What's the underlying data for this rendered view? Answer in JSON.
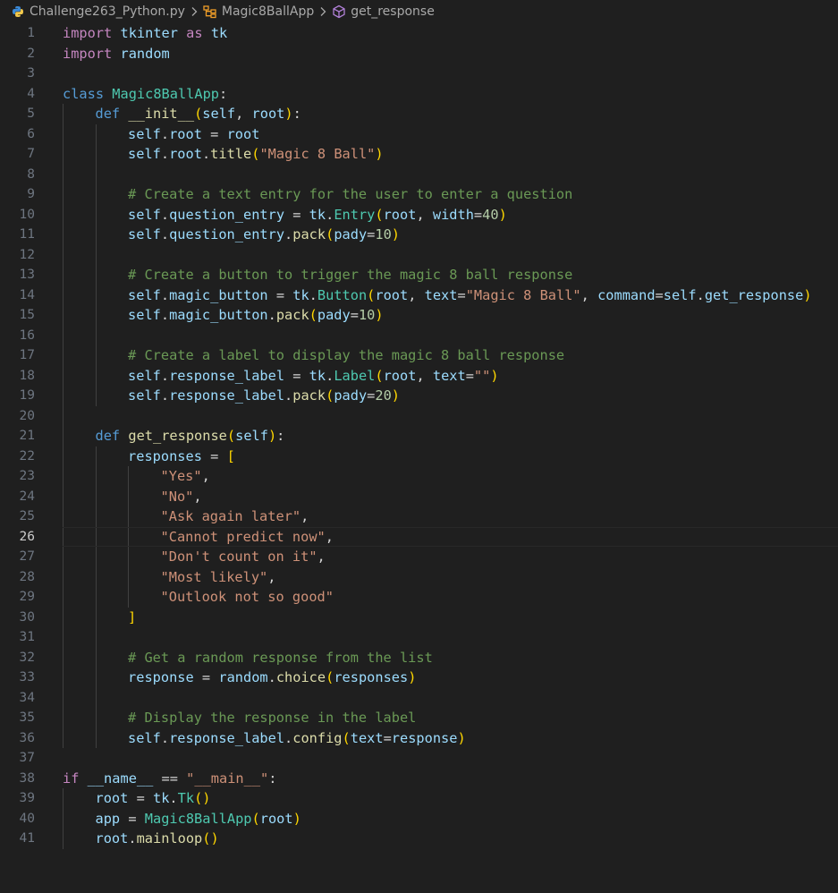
{
  "breadcrumb": {
    "file": "Challenge263_Python.py",
    "class_name": "Magic8BallApp",
    "method_name": "get_response"
  },
  "current_line": 26,
  "colors": {
    "background": "#1f1f1f",
    "line_number": "#6e7681",
    "keyword": "#569cd6",
    "control_keyword": "#c586c0",
    "variable": "#9cdcfe",
    "class": "#4ec9b0",
    "function": "#dcdcaa",
    "string": "#ce9178",
    "number": "#b5cea8",
    "comment": "#6a9955",
    "bracket_level1": "#ffd700",
    "bracket_level2": "#da70d6"
  },
  "lines": [
    {
      "n": "1",
      "indent": 0,
      "tokens": [
        [
          "kc",
          "import"
        ],
        [
          "p",
          " "
        ],
        [
          "n",
          "tkinter"
        ],
        [
          "p",
          " "
        ],
        [
          "kc",
          "as"
        ],
        [
          "p",
          " "
        ],
        [
          "n",
          "tk"
        ]
      ]
    },
    {
      "n": "2",
      "indent": 0,
      "tokens": [
        [
          "kc",
          "import"
        ],
        [
          "p",
          " "
        ],
        [
          "n",
          "random"
        ]
      ]
    },
    {
      "n": "3",
      "indent": 0,
      "tokens": []
    },
    {
      "n": "4",
      "indent": 0,
      "tokens": [
        [
          "k",
          "class"
        ],
        [
          "p",
          " "
        ],
        [
          "c",
          "Magic8BallApp"
        ],
        [
          "p",
          ":"
        ]
      ]
    },
    {
      "n": "5",
      "indent": 1,
      "tokens": [
        [
          "k",
          "def"
        ],
        [
          "p",
          " "
        ],
        [
          "f",
          "__init__"
        ],
        [
          "b1",
          "("
        ],
        [
          "n",
          "self"
        ],
        [
          "p",
          ", "
        ],
        [
          "n",
          "root"
        ],
        [
          "b1",
          ")"
        ],
        [
          "p",
          ":"
        ]
      ]
    },
    {
      "n": "6",
      "indent": 2,
      "tokens": [
        [
          "n",
          "self"
        ],
        [
          "p",
          "."
        ],
        [
          "n",
          "root"
        ],
        [
          "p",
          " = "
        ],
        [
          "n",
          "root"
        ]
      ]
    },
    {
      "n": "7",
      "indent": 2,
      "tokens": [
        [
          "n",
          "self"
        ],
        [
          "p",
          "."
        ],
        [
          "n",
          "root"
        ],
        [
          "p",
          "."
        ],
        [
          "f",
          "title"
        ],
        [
          "b1",
          "("
        ],
        [
          "s",
          "\"Magic 8 Ball\""
        ],
        [
          "b1",
          ")"
        ]
      ]
    },
    {
      "n": "8",
      "indent": 2,
      "tokens": []
    },
    {
      "n": "9",
      "indent": 2,
      "tokens": [
        [
          "cm",
          "# Create a text entry for the user to enter a question"
        ]
      ]
    },
    {
      "n": "10",
      "indent": 2,
      "tokens": [
        [
          "n",
          "self"
        ],
        [
          "p",
          "."
        ],
        [
          "n",
          "question_entry"
        ],
        [
          "p",
          " = "
        ],
        [
          "n",
          "tk"
        ],
        [
          "p",
          "."
        ],
        [
          "c",
          "Entry"
        ],
        [
          "b1",
          "("
        ],
        [
          "n",
          "root"
        ],
        [
          "p",
          ", "
        ],
        [
          "n",
          "width"
        ],
        [
          "p",
          "="
        ],
        [
          "num",
          "40"
        ],
        [
          "b1",
          ")"
        ]
      ]
    },
    {
      "n": "11",
      "indent": 2,
      "tokens": [
        [
          "n",
          "self"
        ],
        [
          "p",
          "."
        ],
        [
          "n",
          "question_entry"
        ],
        [
          "p",
          "."
        ],
        [
          "f",
          "pack"
        ],
        [
          "b1",
          "("
        ],
        [
          "n",
          "pady"
        ],
        [
          "p",
          "="
        ],
        [
          "num",
          "10"
        ],
        [
          "b1",
          ")"
        ]
      ]
    },
    {
      "n": "12",
      "indent": 2,
      "tokens": []
    },
    {
      "n": "13",
      "indent": 2,
      "tokens": [
        [
          "cm",
          "# Create a button to trigger the magic 8 ball response"
        ]
      ]
    },
    {
      "n": "14",
      "indent": 2,
      "tokens": [
        [
          "n",
          "self"
        ],
        [
          "p",
          "."
        ],
        [
          "n",
          "magic_button"
        ],
        [
          "p",
          " = "
        ],
        [
          "n",
          "tk"
        ],
        [
          "p",
          "."
        ],
        [
          "c",
          "Button"
        ],
        [
          "b1",
          "("
        ],
        [
          "n",
          "root"
        ],
        [
          "p",
          ", "
        ],
        [
          "n",
          "text"
        ],
        [
          "p",
          "="
        ],
        [
          "s",
          "\"Magic 8 Ball\""
        ],
        [
          "p",
          ", "
        ],
        [
          "n",
          "command"
        ],
        [
          "p",
          "="
        ],
        [
          "n",
          "self"
        ],
        [
          "p",
          "."
        ],
        [
          "n",
          "get_response"
        ],
        [
          "b1",
          ")"
        ]
      ]
    },
    {
      "n": "15",
      "indent": 2,
      "tokens": [
        [
          "n",
          "self"
        ],
        [
          "p",
          "."
        ],
        [
          "n",
          "magic_button"
        ],
        [
          "p",
          "."
        ],
        [
          "f",
          "pack"
        ],
        [
          "b1",
          "("
        ],
        [
          "n",
          "pady"
        ],
        [
          "p",
          "="
        ],
        [
          "num",
          "10"
        ],
        [
          "b1",
          ")"
        ]
      ]
    },
    {
      "n": "16",
      "indent": 2,
      "tokens": []
    },
    {
      "n": "17",
      "indent": 2,
      "tokens": [
        [
          "cm",
          "# Create a label to display the magic 8 ball response"
        ]
      ]
    },
    {
      "n": "18",
      "indent": 2,
      "tokens": [
        [
          "n",
          "self"
        ],
        [
          "p",
          "."
        ],
        [
          "n",
          "response_label"
        ],
        [
          "p",
          " = "
        ],
        [
          "n",
          "tk"
        ],
        [
          "p",
          "."
        ],
        [
          "c",
          "Label"
        ],
        [
          "b1",
          "("
        ],
        [
          "n",
          "root"
        ],
        [
          "p",
          ", "
        ],
        [
          "n",
          "text"
        ],
        [
          "p",
          "="
        ],
        [
          "s",
          "\"\""
        ],
        [
          "b1",
          ")"
        ]
      ]
    },
    {
      "n": "19",
      "indent": 2,
      "tokens": [
        [
          "n",
          "self"
        ],
        [
          "p",
          "."
        ],
        [
          "n",
          "response_label"
        ],
        [
          "p",
          "."
        ],
        [
          "f",
          "pack"
        ],
        [
          "b1",
          "("
        ],
        [
          "n",
          "pady"
        ],
        [
          "p",
          "="
        ],
        [
          "num",
          "20"
        ],
        [
          "b1",
          ")"
        ]
      ]
    },
    {
      "n": "20",
      "indent": 1,
      "tokens": []
    },
    {
      "n": "21",
      "indent": 1,
      "tokens": [
        [
          "k",
          "def"
        ],
        [
          "p",
          " "
        ],
        [
          "f",
          "get_response"
        ],
        [
          "b1",
          "("
        ],
        [
          "n",
          "self"
        ],
        [
          "b1",
          ")"
        ],
        [
          "p",
          ":"
        ]
      ]
    },
    {
      "n": "22",
      "indent": 2,
      "tokens": [
        [
          "n",
          "responses"
        ],
        [
          "p",
          " = "
        ],
        [
          "b1",
          "["
        ]
      ]
    },
    {
      "n": "23",
      "indent": 3,
      "tokens": [
        [
          "s",
          "\"Yes\""
        ],
        [
          "p",
          ","
        ]
      ]
    },
    {
      "n": "24",
      "indent": 3,
      "tokens": [
        [
          "s",
          "\"No\""
        ],
        [
          "p",
          ","
        ]
      ]
    },
    {
      "n": "25",
      "indent": 3,
      "tokens": [
        [
          "s",
          "\"Ask again later\""
        ],
        [
          "p",
          ","
        ]
      ]
    },
    {
      "n": "26",
      "indent": 3,
      "tokens": [
        [
          "s",
          "\"Cannot predict now\""
        ],
        [
          "p",
          ","
        ]
      ]
    },
    {
      "n": "27",
      "indent": 3,
      "tokens": [
        [
          "s",
          "\"Don't count on it\""
        ],
        [
          "p",
          ","
        ]
      ]
    },
    {
      "n": "28",
      "indent": 3,
      "tokens": [
        [
          "s",
          "\"Most likely\""
        ],
        [
          "p",
          ","
        ]
      ]
    },
    {
      "n": "29",
      "indent": 3,
      "tokens": [
        [
          "s",
          "\"Outlook not so good\""
        ]
      ]
    },
    {
      "n": "30",
      "indent": 2,
      "tokens": [
        [
          "b1",
          "]"
        ]
      ]
    },
    {
      "n": "31",
      "indent": 2,
      "tokens": []
    },
    {
      "n": "32",
      "indent": 2,
      "tokens": [
        [
          "cm",
          "# Get a random response from the list"
        ]
      ]
    },
    {
      "n": "33",
      "indent": 2,
      "tokens": [
        [
          "n",
          "response"
        ],
        [
          "p",
          " = "
        ],
        [
          "n",
          "random"
        ],
        [
          "p",
          "."
        ],
        [
          "f",
          "choice"
        ],
        [
          "b1",
          "("
        ],
        [
          "n",
          "responses"
        ],
        [
          "b1",
          ")"
        ]
      ]
    },
    {
      "n": "34",
      "indent": 2,
      "tokens": []
    },
    {
      "n": "35",
      "indent": 2,
      "tokens": [
        [
          "cm",
          "# Display the response in the label"
        ]
      ]
    },
    {
      "n": "36",
      "indent": 2,
      "tokens": [
        [
          "n",
          "self"
        ],
        [
          "p",
          "."
        ],
        [
          "n",
          "response_label"
        ],
        [
          "p",
          "."
        ],
        [
          "f",
          "config"
        ],
        [
          "b1",
          "("
        ],
        [
          "n",
          "text"
        ],
        [
          "p",
          "="
        ],
        [
          "n",
          "response"
        ],
        [
          "b1",
          ")"
        ]
      ]
    },
    {
      "n": "37",
      "indent": 0,
      "tokens": []
    },
    {
      "n": "38",
      "indent": 0,
      "tokens": [
        [
          "kc",
          "if"
        ],
        [
          "p",
          " "
        ],
        [
          "n",
          "__name__"
        ],
        [
          "p",
          " == "
        ],
        [
          "s",
          "\"__main__\""
        ],
        [
          "p",
          ":"
        ]
      ]
    },
    {
      "n": "39",
      "indent": 1,
      "tokens": [
        [
          "n",
          "root"
        ],
        [
          "p",
          " = "
        ],
        [
          "n",
          "tk"
        ],
        [
          "p",
          "."
        ],
        [
          "c",
          "Tk"
        ],
        [
          "b1",
          "()"
        ]
      ]
    },
    {
      "n": "40",
      "indent": 1,
      "tokens": [
        [
          "n",
          "app"
        ],
        [
          "p",
          " = "
        ],
        [
          "c",
          "Magic8BallApp"
        ],
        [
          "b1",
          "("
        ],
        [
          "n",
          "root"
        ],
        [
          "b1",
          ")"
        ]
      ]
    },
    {
      "n": "41",
      "indent": 1,
      "tokens": [
        [
          "n",
          "root"
        ],
        [
          "p",
          "."
        ],
        [
          "f",
          "mainloop"
        ],
        [
          "b1",
          "()"
        ]
      ]
    }
  ]
}
